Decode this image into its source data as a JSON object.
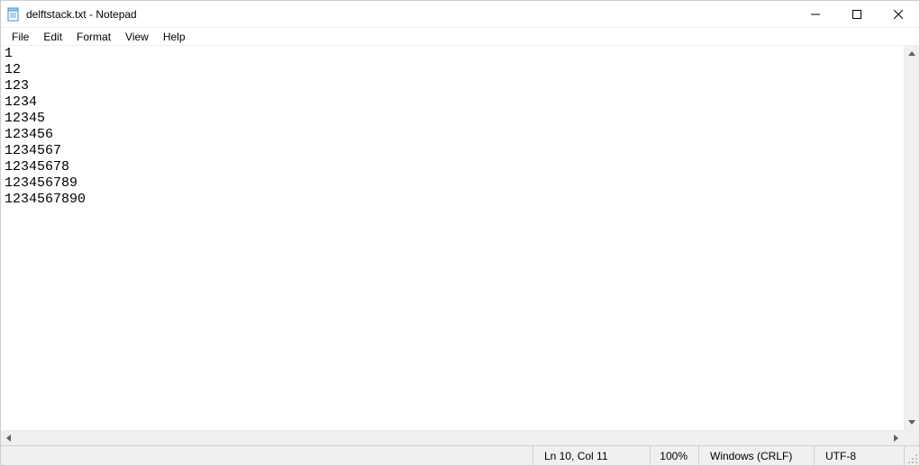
{
  "window": {
    "title": "delftstack.txt - Notepad"
  },
  "menubar": {
    "items": [
      "File",
      "Edit",
      "Format",
      "View",
      "Help"
    ]
  },
  "editor": {
    "lines": [
      "1",
      "12",
      "123",
      "1234",
      "12345",
      "123456",
      "1234567",
      "12345678",
      "123456789",
      "1234567890"
    ]
  },
  "statusbar": {
    "position": "Ln 10, Col 11",
    "zoom": "100%",
    "line_ending": "Windows (CRLF)",
    "encoding": "UTF-8"
  }
}
